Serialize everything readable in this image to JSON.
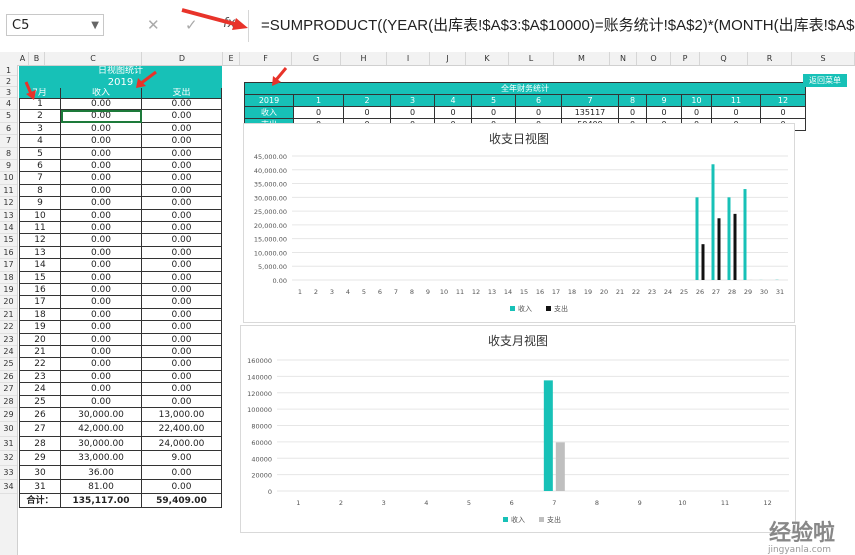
{
  "namebox": "C5",
  "formula": "=SUMPRODUCT((YEAR(出库表!$A$3:$A$10000)=账务统计!$A$2)*(MONTH(出库表!$A$3:$A$",
  "fx": "fx",
  "columns": [
    "A",
    "B",
    "C",
    "D",
    "E",
    "F",
    "G",
    "H",
    "I",
    "J",
    "K",
    "L",
    "M",
    "N",
    "O",
    "P",
    "Q",
    "R",
    "S"
  ],
  "left": {
    "title": "日视图统计",
    "year": "2019",
    "month_header": "7月",
    "col_income": "收入",
    "col_expense": "支出",
    "rows": [
      [
        "1",
        "0.00",
        "0.00"
      ],
      [
        "2",
        "0.00",
        "0.00"
      ],
      [
        "3",
        "0.00",
        "0.00"
      ],
      [
        "4",
        "0.00",
        "0.00"
      ],
      [
        "5",
        "0.00",
        "0.00"
      ],
      [
        "6",
        "0.00",
        "0.00"
      ],
      [
        "7",
        "0.00",
        "0.00"
      ],
      [
        "8",
        "0.00",
        "0.00"
      ],
      [
        "9",
        "0.00",
        "0.00"
      ],
      [
        "10",
        "0.00",
        "0.00"
      ],
      [
        "11",
        "0.00",
        "0.00"
      ],
      [
        "12",
        "0.00",
        "0.00"
      ],
      [
        "13",
        "0.00",
        "0.00"
      ],
      [
        "14",
        "0.00",
        "0.00"
      ],
      [
        "15",
        "0.00",
        "0.00"
      ],
      [
        "16",
        "0.00",
        "0.00"
      ],
      [
        "17",
        "0.00",
        "0.00"
      ],
      [
        "18",
        "0.00",
        "0.00"
      ],
      [
        "19",
        "0.00",
        "0.00"
      ],
      [
        "20",
        "0.00",
        "0.00"
      ],
      [
        "21",
        "0.00",
        "0.00"
      ],
      [
        "22",
        "0.00",
        "0.00"
      ],
      [
        "23",
        "0.00",
        "0.00"
      ],
      [
        "24",
        "0.00",
        "0.00"
      ],
      [
        "25",
        "0.00",
        "0.00"
      ],
      [
        "26",
        "30,000.00",
        "13,000.00"
      ],
      [
        "27",
        "42,000.00",
        "22,400.00"
      ],
      [
        "28",
        "30,000.00",
        "24,000.00"
      ],
      [
        "29",
        "33,000.00",
        "9.00"
      ],
      [
        "30",
        "36.00",
        "0.00"
      ],
      [
        "31",
        "81.00",
        "0.00"
      ]
    ],
    "total_label": "合计：",
    "total_income": "135,117.00",
    "total_expense": "59,409.00"
  },
  "row_numbers": [
    "1",
    "2",
    "3",
    "4",
    "5",
    "6",
    "7",
    "8",
    "9",
    "10",
    "11",
    "12",
    "13",
    "14",
    "15",
    "16",
    "17",
    "18",
    "19",
    "20",
    "21",
    "22",
    "23",
    "24",
    "25",
    "26",
    "27",
    "28",
    "29",
    "30",
    "31",
    "32",
    "33",
    "34"
  ],
  "year_table": {
    "title": "全年财务统计",
    "year": "2019",
    "months": [
      "1",
      "2",
      "3",
      "4",
      "5",
      "6",
      "7",
      "8",
      "9",
      "10",
      "11",
      "12"
    ],
    "income_label": "收入",
    "expense_label": "支出",
    "income": [
      "0",
      "0",
      "0",
      "0",
      "0",
      "0",
      "135117",
      "0",
      "0",
      "0",
      "0",
      "0"
    ],
    "expense": [
      "0",
      "0",
      "0",
      "0",
      "0",
      "0",
      "59409",
      "0",
      "0",
      "0",
      "0",
      "0"
    ]
  },
  "menu_button": "返回菜单",
  "chart_data": [
    {
      "type": "bar",
      "title": "收支日视图",
      "categories": [
        "1",
        "2",
        "3",
        "4",
        "5",
        "6",
        "7",
        "8",
        "9",
        "10",
        "11",
        "12",
        "13",
        "14",
        "15",
        "16",
        "17",
        "18",
        "19",
        "20",
        "21",
        "22",
        "23",
        "24",
        "25",
        "26",
        "27",
        "28",
        "29",
        "30",
        "31"
      ],
      "series": [
        {
          "name": "收入",
          "color": "#17c1b7",
          "values": [
            0,
            0,
            0,
            0,
            0,
            0,
            0,
            0,
            0,
            0,
            0,
            0,
            0,
            0,
            0,
            0,
            0,
            0,
            0,
            0,
            0,
            0,
            0,
            0,
            0,
            30000,
            42000,
            30000,
            33000,
            36,
            81
          ]
        },
        {
          "name": "支出",
          "color": "#111111",
          "values": [
            0,
            0,
            0,
            0,
            0,
            0,
            0,
            0,
            0,
            0,
            0,
            0,
            0,
            0,
            0,
            0,
            0,
            0,
            0,
            0,
            0,
            0,
            0,
            0,
            0,
            13000,
            22400,
            24000,
            9,
            0,
            0
          ]
        }
      ],
      "yticks": [
        "0.00",
        "5,000.00",
        "10,000.00",
        "15,000.00",
        "20,000.00",
        "25,000.00",
        "30,000.00",
        "35,000.00",
        "40,000.00",
        "45,000.00"
      ],
      "ylim": [
        0,
        45000
      ],
      "legend": "bottom"
    },
    {
      "type": "bar",
      "title": "收支月视图",
      "categories": [
        "1",
        "2",
        "3",
        "4",
        "5",
        "6",
        "7",
        "8",
        "9",
        "10",
        "11",
        "12"
      ],
      "series": [
        {
          "name": "收入",
          "color": "#17c1b7",
          "values": [
            0,
            0,
            0,
            0,
            0,
            0,
            135117,
            0,
            0,
            0,
            0,
            0
          ]
        },
        {
          "name": "支出",
          "color": "#bfbfbf",
          "values": [
            0,
            0,
            0,
            0,
            0,
            0,
            59409,
            0,
            0,
            0,
            0,
            0
          ]
        }
      ],
      "yticks": [
        "0",
        "20000",
        "40000",
        "60000",
        "80000",
        "100000",
        "120000",
        "140000",
        "160000"
      ],
      "ylim": [
        0,
        160000
      ],
      "legend": "bottom"
    }
  ],
  "watermark": "经验啦",
  "watermark_url": "jingyanla.com"
}
